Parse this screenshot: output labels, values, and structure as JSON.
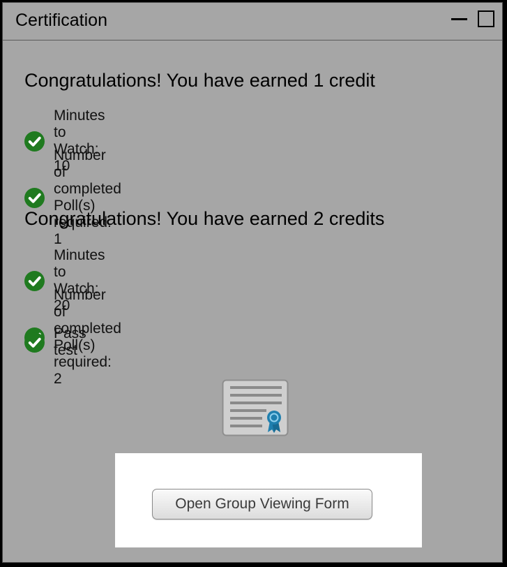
{
  "window": {
    "title": "Certification"
  },
  "sections": [
    {
      "heading": "Congratulations! You have earned 1 credit",
      "requirements": [
        "Minutes to Watch: 10",
        "Number of completed Poll(s) required: 1"
      ]
    },
    {
      "heading": "Congratulations! You have earned 2 credits",
      "requirements": [
        "Minutes to Watch: 20",
        "Number of completed Poll(s) required: 2",
        "Pass test"
      ]
    }
  ],
  "form": {
    "button_label": "Open Group Viewing Form"
  },
  "colors": {
    "check": "#1f7a1f",
    "panel": "#a6a6a6",
    "badge": "#1f7fae"
  }
}
